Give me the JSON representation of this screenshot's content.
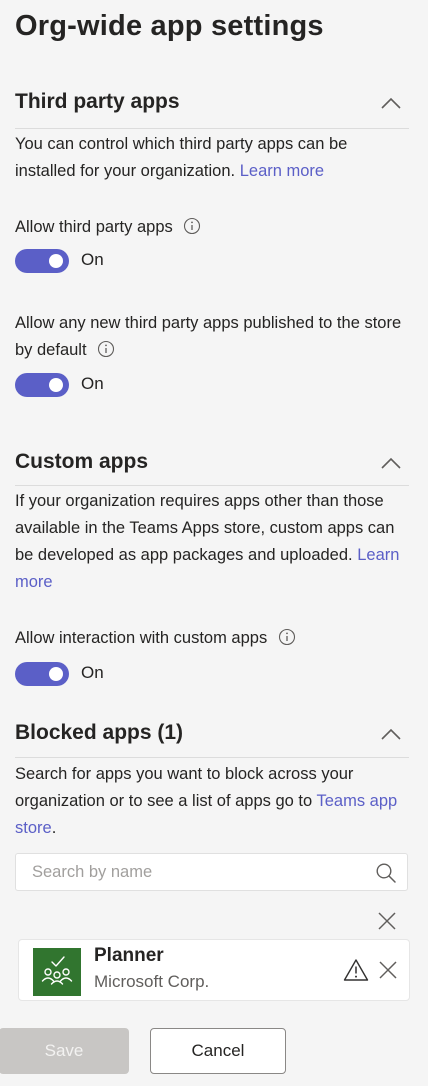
{
  "page": {
    "title": "Org-wide app settings"
  },
  "third_party": {
    "title": "Third party apps",
    "desc_text": "You can control which third party apps can be installed for your organization.",
    "learn_more": "Learn more",
    "allow_label": "Allow third party apps",
    "allow_state": "On",
    "allow_new_label": "Allow any new third party apps published to the store by default",
    "allow_new_state": "On"
  },
  "custom": {
    "title": "Custom apps",
    "desc_text": "If your organization requires apps other than those available in the Teams Apps store, custom apps can be developed as app packages and uploaded.",
    "learn_more": "Learn more",
    "allow_label": "Allow interaction with custom apps",
    "allow_state": "On"
  },
  "blocked": {
    "title": "Blocked apps (1)",
    "desc_text": "Search for apps you want to block across your organization or to see a list of apps go to",
    "store_link": "Teams app store",
    "desc_end": ".",
    "search_placeholder": "Search by name",
    "search_value": "",
    "apps": [
      {
        "name": "Planner",
        "publisher": "Microsoft Corp."
      }
    ]
  },
  "footer": {
    "save_label": "Save",
    "cancel_label": "Cancel"
  },
  "icons": {
    "collapse": "chevron-up-icon",
    "info": "info-icon",
    "search": "search-icon",
    "close": "close-icon",
    "warning": "warning-icon",
    "planner_logo": "planner-logo-icon"
  },
  "colors": {
    "accent": "#5b5fc7",
    "background": "#f5f5f5",
    "planner_green": "#31752f",
    "disabled_button": "#c8c6c4"
  }
}
